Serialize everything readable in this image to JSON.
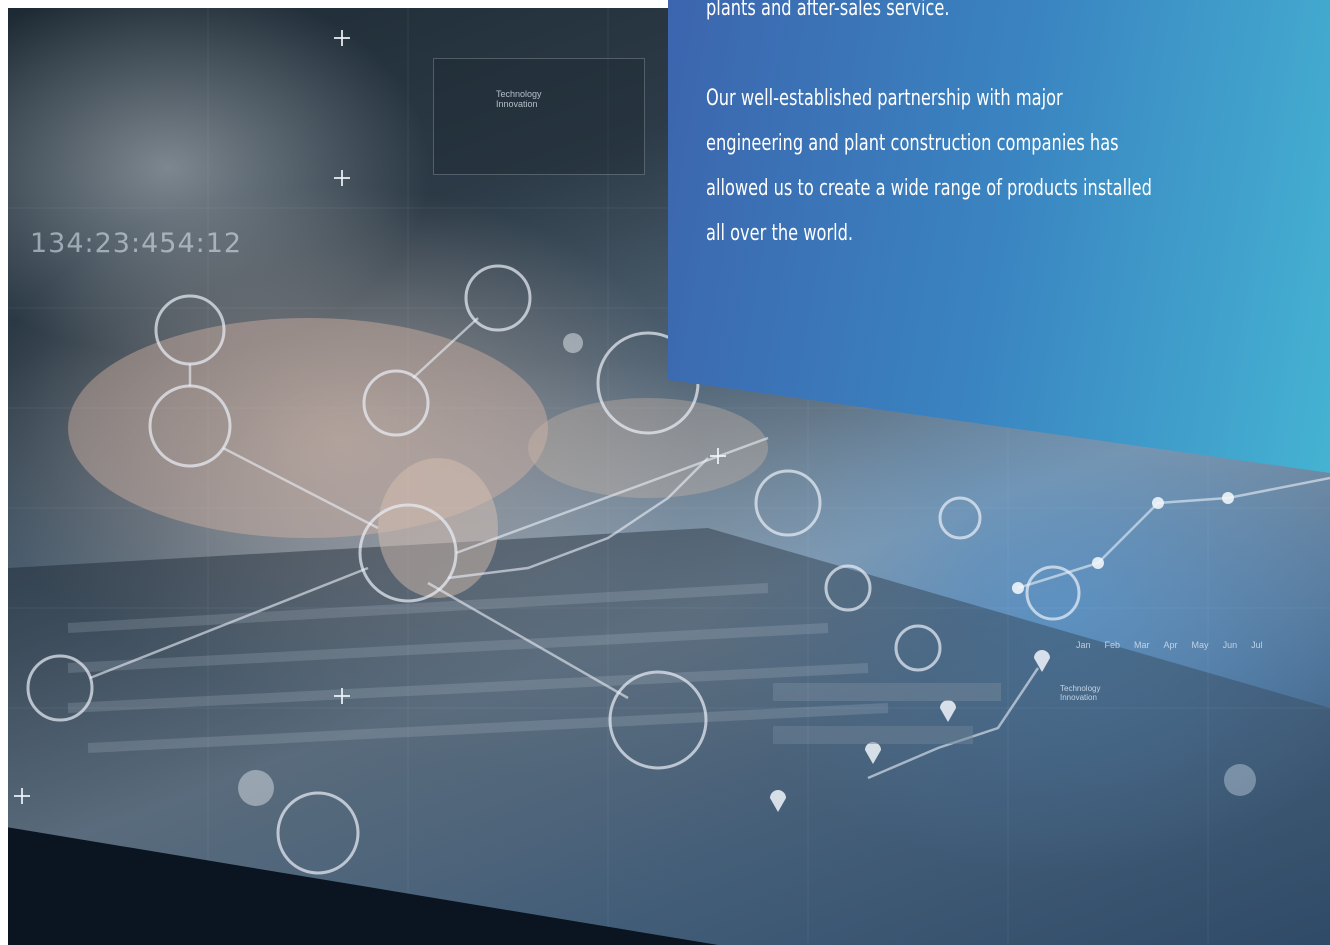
{
  "panel": {
    "paragraph_1": "plants and after-sales service.",
    "paragraph_2_line_1": "Our well-established partnership with major",
    "paragraph_2_line_2": "engineering and plant construction companies has",
    "paragraph_2_line_3": "allowed us to create a wide range of products installed",
    "paragraph_2_line_4": "all over the world."
  },
  "overlay": {
    "timestamp": "134:23:454:12",
    "screen_card_title": "Technology Innovation",
    "bubble_label": "Technology Innovation",
    "months": [
      "Jan",
      "Feb",
      "Mar",
      "Apr",
      "May",
      "Jun",
      "Jul"
    ]
  },
  "colors": {
    "panel_start": "#3c65ae",
    "panel_end": "#45b3d2",
    "bottom_band": "#0b1421"
  }
}
